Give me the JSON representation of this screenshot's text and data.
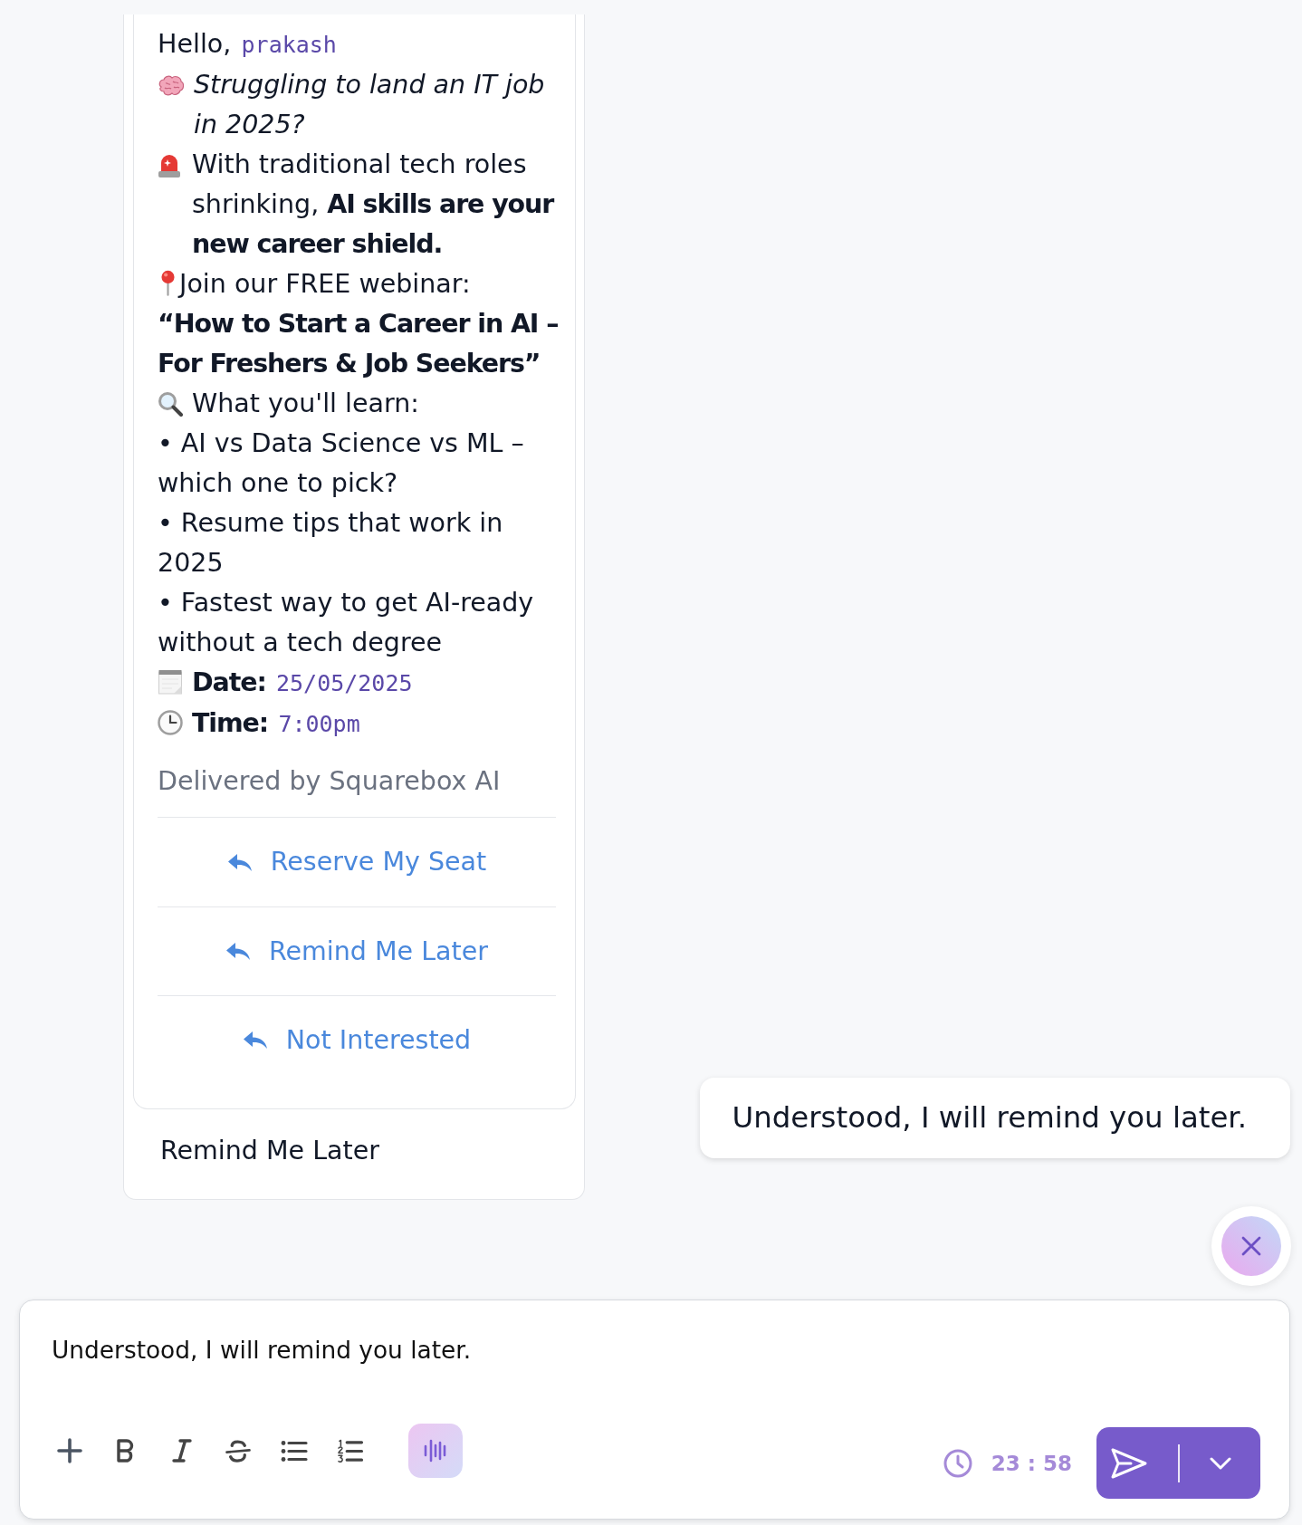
{
  "message": {
    "greeting": "Hello,",
    "recipient": "prakash",
    "hook": "Struggling to land an IT job in 2025?",
    "alert": "With traditional tech roles shrinking, **AI skills are your new career shield.**",
    "invite": "Join our FREE webinar:",
    "webinar_title": "“How to Start a Career in AI – For Freshers & Job Seekers”",
    "learn_heading": "What you'll learn:",
    "learn_points": [
      "• AI vs Data Science vs ML – which one to pick?",
      "• Resume tips that work in 2025",
      "• Fastest way to get AI-ready without a tech degree"
    ],
    "date": {
      "label": "Date:",
      "value": "25/05/2025"
    },
    "time": {
      "label": "Time:",
      "value": "7:00pm"
    },
    "footer": "Delivered by Squarebox AI",
    "quick_replies": [
      "Reserve My Seat",
      "Remind Me Later",
      "Not Interested"
    ],
    "chosen_reply": "Remind Me Later"
  },
  "outgoing_message": {
    "text": "Understood, I will remind you later."
  },
  "composer": {
    "value": "Understood, I will remind you later.",
    "timer": "23 : 58"
  }
}
